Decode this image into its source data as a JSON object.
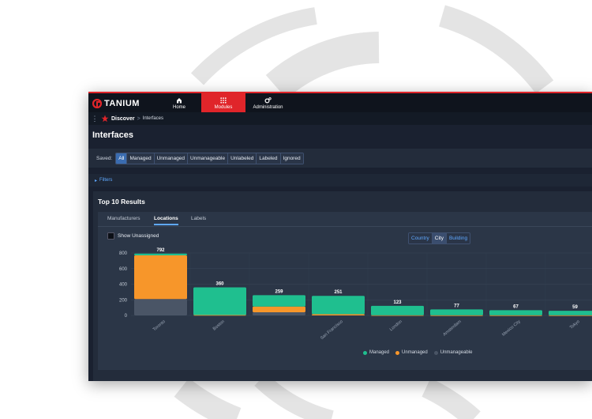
{
  "nav": {
    "brand": "TANIUM",
    "items": [
      {
        "label": "Home",
        "icon": "home-icon"
      },
      {
        "label": "Modules",
        "icon": "grid-icon"
      },
      {
        "label": "Administration",
        "icon": "gear-icon"
      }
    ],
    "accent": "#e0252a"
  },
  "breadcrumb": {
    "module": "Discover",
    "separator": ">",
    "current": "Interfaces"
  },
  "page": {
    "title": "Interfaces"
  },
  "saved": {
    "label": "Saved:",
    "options": [
      "All",
      "Managed",
      "Unmanaged",
      "Unmanageable",
      "Unlabeled",
      "Labeled",
      "Ignored"
    ],
    "selected": "All"
  },
  "filters": {
    "label": "Filters"
  },
  "results": {
    "title": "Top 10 Results",
    "tabs": [
      "Manufacturers",
      "Locations",
      "Labels"
    ],
    "active_tab": "Locations",
    "show_unassigned": "Show Unassigned",
    "location_toggle": [
      "Country",
      "City",
      "Building"
    ],
    "location_selected": "City"
  },
  "chart_data": {
    "type": "bar",
    "stacked": true,
    "categories": [
      "Toronto",
      "Boston",
      "",
      "San Francisco",
      "London",
      "Amsterdam",
      "Mexico City",
      "Tokyo"
    ],
    "totals": [
      792,
      360,
      259,
      251,
      123,
      77,
      67,
      59
    ],
    "series": [
      {
        "name": "Managed",
        "color": "#1fbf8f",
        "values": [
          22,
          355,
          145,
          235,
          120,
          75,
          65,
          57
        ]
      },
      {
        "name": "Unmanaged",
        "color": "#f7962a",
        "values": [
          560,
          5,
          74,
          16,
          3,
          2,
          2,
          2
        ]
      },
      {
        "name": "Unmanageable",
        "color": "#4a5566",
        "values": [
          210,
          0,
          40,
          0,
          0,
          0,
          0,
          0
        ]
      }
    ],
    "ylim": [
      0,
      800
    ],
    "yticks": [
      0,
      200,
      400,
      600,
      800
    ],
    "grid": true,
    "legend": "bottom"
  }
}
